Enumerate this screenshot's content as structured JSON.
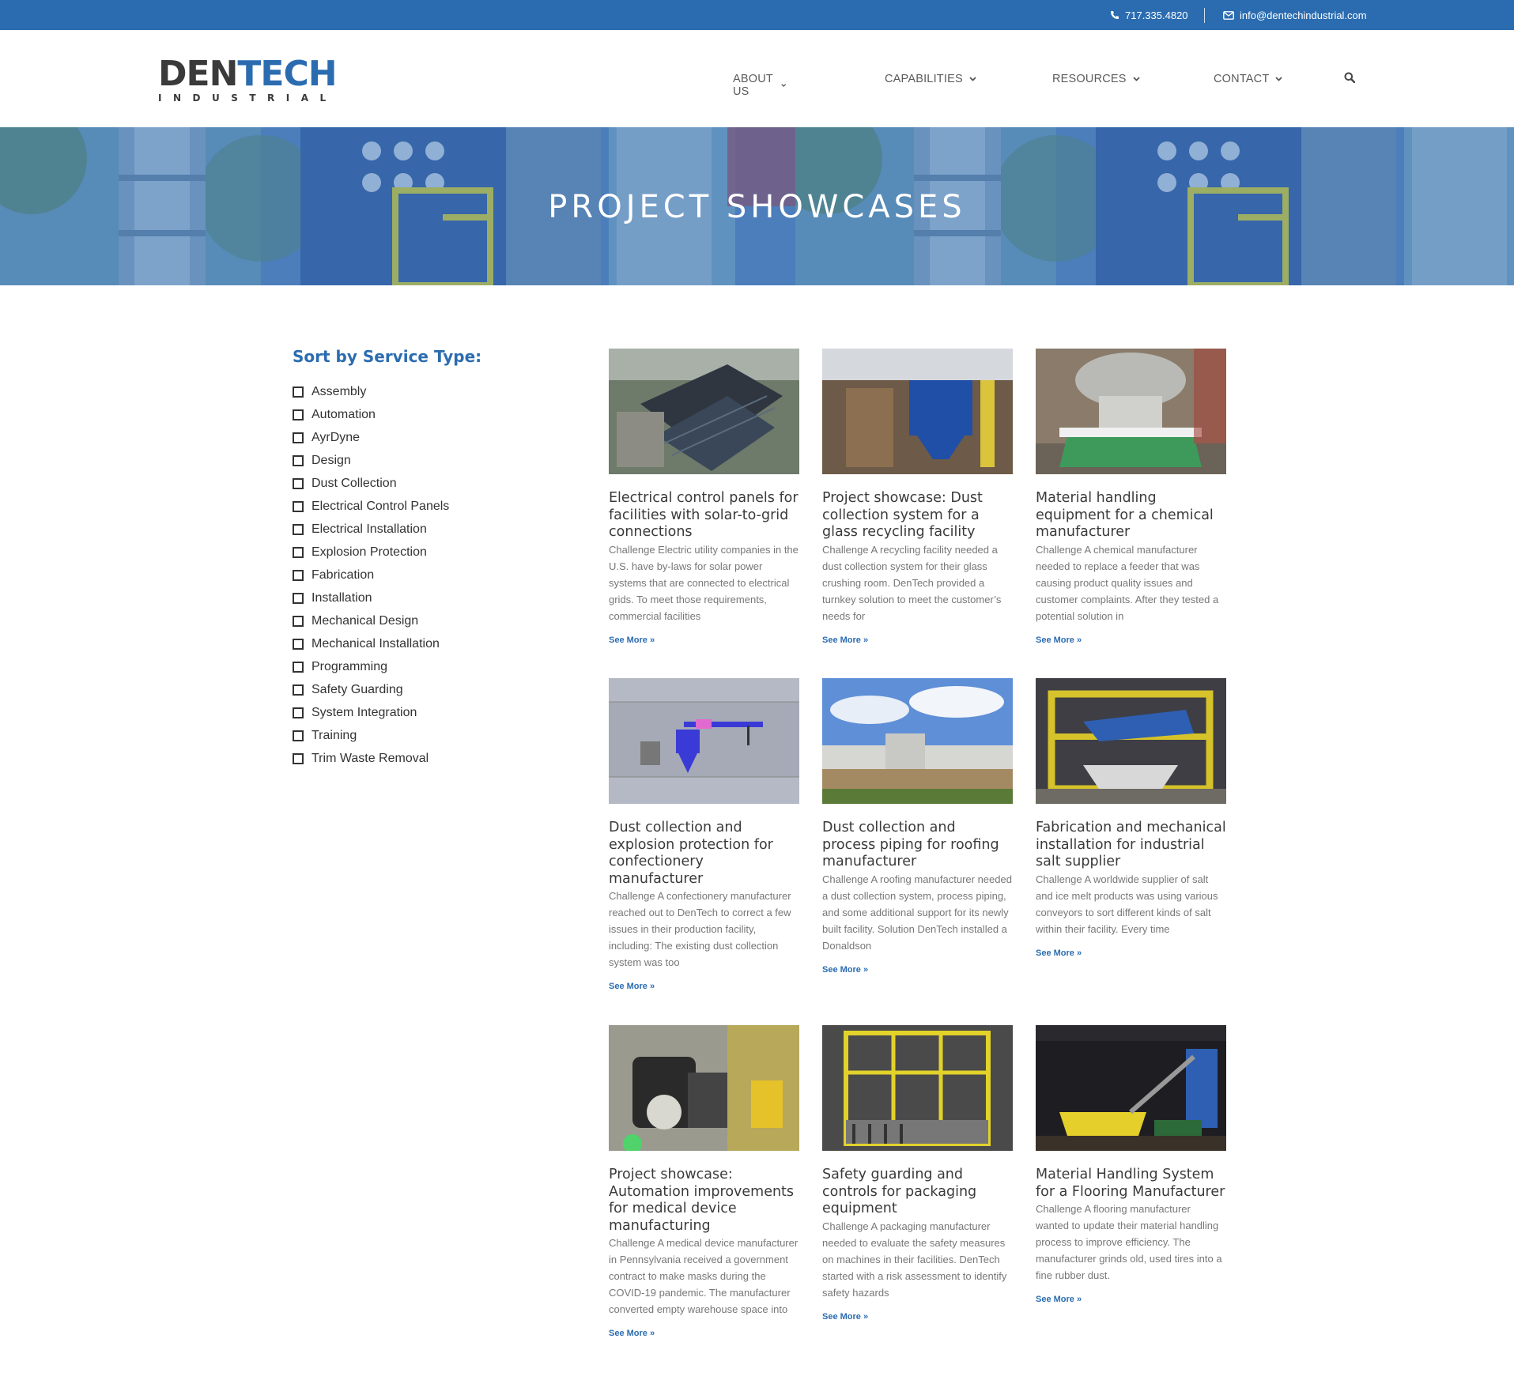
{
  "topbar": {
    "phone": "717.335.4820",
    "email": "info@dentechindustrial.com"
  },
  "logo": {
    "word_dark": "DEN",
    "word_blue": "TECH",
    "sub": "INDUSTRIAL"
  },
  "nav": {
    "items": [
      "ABOUT US",
      "CAPABILITIES",
      "RESOURCES",
      "CONTACT"
    ]
  },
  "hero": {
    "title": "PROJECT SHOWCASES"
  },
  "filter": {
    "title": "Sort by Service Type:",
    "options": [
      "Assembly",
      "Automation",
      "AyrDyne",
      "Design",
      "Dust Collection",
      "Electrical Control Panels",
      "Electrical Installation",
      "Explosion Protection",
      "Fabrication",
      "Installation",
      "Mechanical Design",
      "Mechanical Installation",
      "Programming",
      "Safety Guarding",
      "System Integration",
      "Training",
      "Trim Waste Removal"
    ]
  },
  "cards": [
    {
      "title": "Electrical control panels for facilities with solar-to-grid connections",
      "excerpt": "Challenge Electric utility companies in the U.S. have by-laws for solar power systems that are connected to electrical grids. To meet those requirements, commercial facilities",
      "more": "See More »"
    },
    {
      "title": "Project showcase: Dust collection system for a glass recycling facility",
      "excerpt": "Challenge A recycling facility needed a dust collection system for their glass crushing room. DenTech provided a turnkey solution to meet the customer’s needs for",
      "more": "See More »"
    },
    {
      "title": "Material handling equipment for a chemical manufacturer",
      "excerpt": "Challenge A chemical manufacturer needed to replace a feeder that was causing product quality issues and customer complaints. After they tested a potential solution in",
      "more": "See More »"
    },
    {
      "title": "Dust collection and explosion protection for confectionery manufacturer",
      "excerpt": "Challenge A confectionery manufacturer reached out to DenTech to correct a few issues in their production facility, including: The existing dust collection system was too",
      "more": "See More »"
    },
    {
      "title": "Dust collection and process piping for roofing manufacturer",
      "excerpt": "Challenge A roofing manufacturer needed a dust collection system, process piping, and some additional support for its newly built facility. Solution DenTech installed a Donaldson",
      "more": "See More »"
    },
    {
      "title": "Fabrication and mechanical installation for industrial salt supplier",
      "excerpt": "Challenge A worldwide supplier of salt and ice melt products was using various conveyors to sort different kinds of salt within their facility. Every time",
      "more": "See More »"
    },
    {
      "title": "Project showcase: Automation improvements for medical device manufacturing",
      "excerpt": "Challenge A medical device manufacturer in Pennsylvania received a government contract to make masks during the COVID-19 pandemic. The manufacturer converted empty warehouse space into",
      "more": "See More »"
    },
    {
      "title": "Safety guarding and controls for packaging equipment",
      "excerpt": "Challenge A packaging manufacturer needed to evaluate the safety measures on machines in their facilities. DenTech started with a risk assessment to identify safety hazards",
      "more": "See More »"
    },
    {
      "title": "Material Handling System for a Flooring Manufacturer",
      "excerpt": "Challenge A flooring manufacturer wanted to update their material handling process to improve efficiency. The manufacturer grinds old, used tires into a fine rubber dust.",
      "more": "See More »"
    }
  ]
}
